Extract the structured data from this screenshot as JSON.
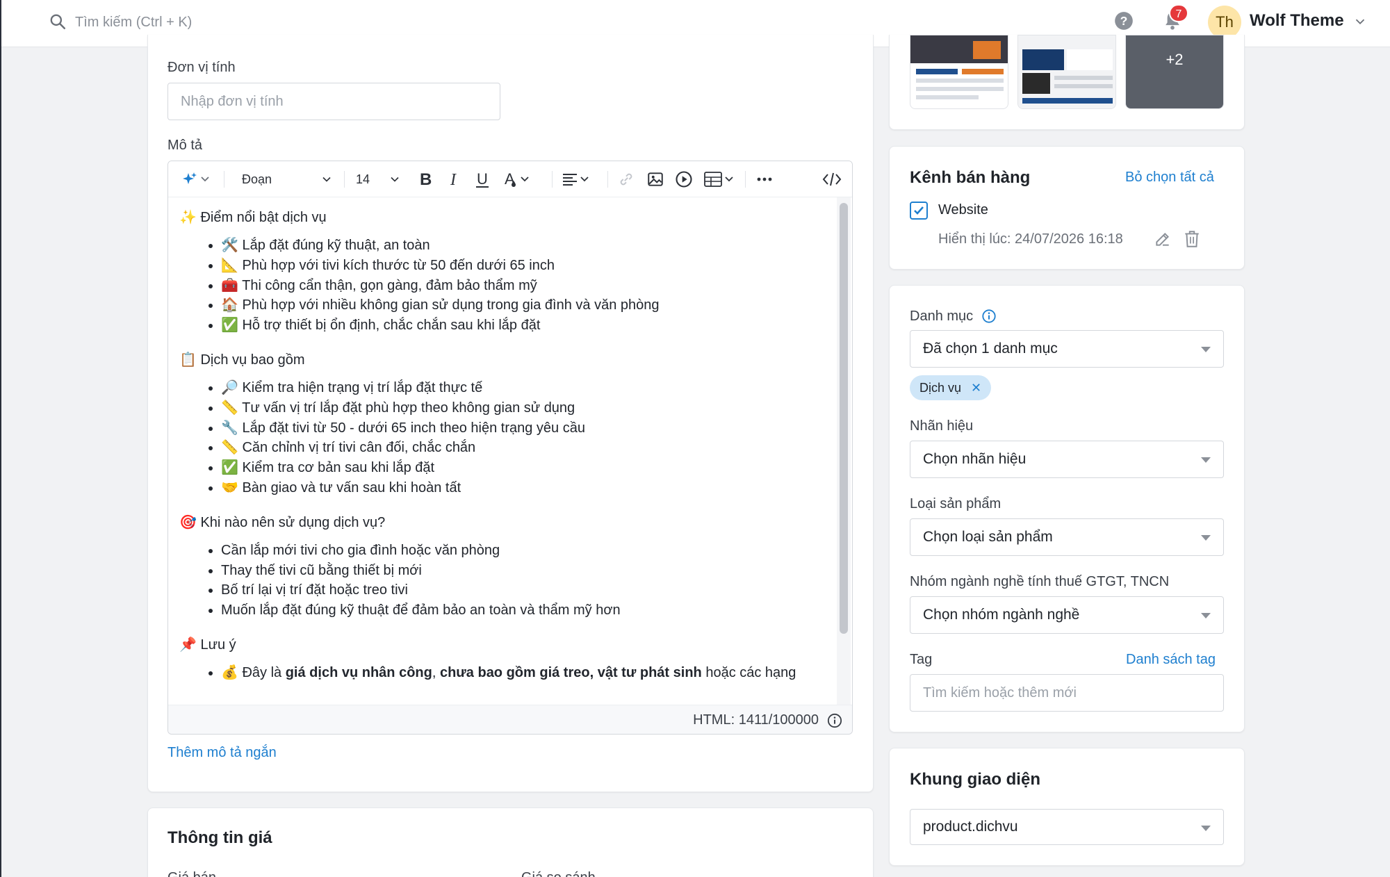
{
  "header": {
    "search_placeholder": "Tìm kiếm (Ctrl + K)",
    "notification_count": "7",
    "avatar_initials": "Th",
    "user_name": "Wolf Theme"
  },
  "unit": {
    "label": "Đơn vị tính",
    "placeholder": "Nhập đơn vị tính"
  },
  "description": {
    "label": "Mô tả",
    "toolbar": {
      "paragraph": "Đoạn",
      "font_size": "14"
    },
    "sections": [
      {
        "heading": "✨ Điểm nổi bật dịch vụ",
        "items": [
          "🛠️ Lắp đặt đúng kỹ thuật, an toàn",
          "📐 Phù hợp với tivi kích thước từ 50 đến dưới 65 inch",
          "🧰 Thi công cẩn thận, gọn gàng, đảm bảo thẩm mỹ",
          "🏠 Phù hợp với nhiều không gian sử dụng trong gia đình và văn phòng",
          "✅ Hỗ trợ thiết bị ổn định, chắc chắn sau khi lắp đặt"
        ]
      },
      {
        "heading": "📋 Dịch vụ bao gồm",
        "items": [
          "🔎 Kiểm tra hiện trạng vị trí lắp đặt thực tế",
          "📏 Tư vấn vị trí lắp đặt phù hợp theo không gian sử dụng",
          "🔧 Lắp đặt tivi từ 50 - dưới 65 inch theo hiện trạng yêu cầu",
          "📏 Căn chỉnh vị trí tivi cân đối, chắc chắn",
          "✅ Kiểm tra cơ bản sau khi lắp đặt",
          "🤝 Bàn giao và tư vấn sau khi hoàn tất"
        ]
      },
      {
        "heading": "🎯 Khi nào nên sử dụng dịch vụ?",
        "items": [
          "Cần lắp mới tivi cho gia đình hoặc văn phòng",
          "Thay thế tivi cũ bằng thiết bị mới",
          "Bố trí lại vị trí đặt hoặc treo tivi",
          "Muốn lắp đặt đúng kỹ thuật để đảm bảo an toàn và thẩm mỹ hơn"
        ]
      },
      {
        "heading": "📌 Lưu ý",
        "items": []
      }
    ],
    "note_item": {
      "prefix": "💰 Đây là ",
      "bold1": "giá dịch vụ nhân công",
      "sep1": ", ",
      "bold2": "chưa bao gồm giá treo, vật tư phát sinh",
      "suffix": " hoặc các hạng"
    },
    "html_count": "HTML: 1411/100000",
    "short_desc_link": "Thêm mô tả ngắn"
  },
  "price": {
    "title": "Thông tin giá",
    "sell_label": "Giá bán",
    "compare_label": "Giá so sánh"
  },
  "media": {
    "more_count": "+2"
  },
  "channels": {
    "title": "Kênh bán hàng",
    "deselect_all": "Bỏ chọn tất cả",
    "website_label": "Website",
    "website_checked": true,
    "display_time": "Hiển thị lúc: 24/07/2026 16:18"
  },
  "category": {
    "label": "Danh mục",
    "selected": "Đã chọn 1 danh mục",
    "chip": "Dịch vụ",
    "brand_label": "Nhãn hiệu",
    "brand_placeholder": "Chọn nhãn hiệu",
    "type_label": "Loại sản phẩm",
    "type_placeholder": "Chọn loại sản phẩm",
    "tax_label": "Nhóm ngành nghề tính thuế GTGT, TNCN",
    "tax_placeholder": "Chọn nhóm ngành nghề",
    "tag_label": "Tag",
    "tag_list_link": "Danh sách tag",
    "tag_placeholder": "Tìm kiếm hoặc thêm mới"
  },
  "layout": {
    "title": "Khung giao diện",
    "template": "product.dichvu"
  },
  "colors": {
    "accent": "#1e7fcf",
    "badge": "#e5383b",
    "chip_bg": "#cfe6f8"
  }
}
